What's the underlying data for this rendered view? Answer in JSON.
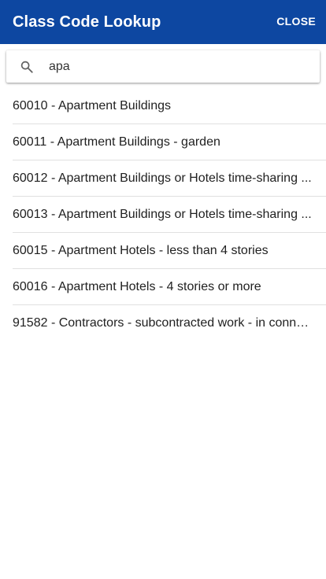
{
  "header": {
    "title": "Class Code Lookup",
    "close_label": "CLOSE",
    "background_color": "#0d47a1"
  },
  "search": {
    "icon": "search-icon",
    "value": "apa"
  },
  "results": [
    {
      "label": "60010 - Apartment Buildings"
    },
    {
      "label": "60011 - Apartment Buildings - garden"
    },
    {
      "label": "60012 - Apartment Buildings or Hotels time-sharing ..."
    },
    {
      "label": "60013 - Apartment Buildings or Hotels time-sharing ..."
    },
    {
      "label": "60015 - Apartment Hotels - less than 4 stories"
    },
    {
      "label": "60016 - Apartment Hotels - 4 stories or more"
    },
    {
      "label": "91582 - Contractors - subcontracted work - in conne..."
    }
  ]
}
